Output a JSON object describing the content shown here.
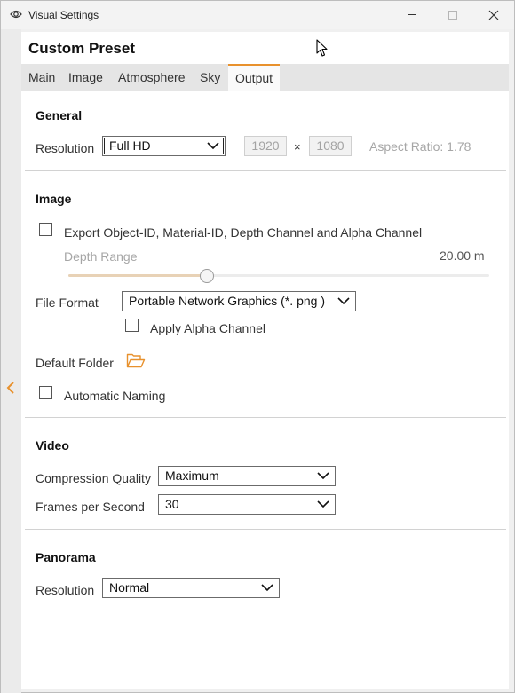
{
  "window": {
    "title": "Visual Settings"
  },
  "preset": {
    "title": "Custom Preset"
  },
  "tabs": [
    {
      "label": "Main"
    },
    {
      "label": "Image"
    },
    {
      "label": "Atmosphere"
    },
    {
      "label": "Sky"
    },
    {
      "label": "Output",
      "active": true
    }
  ],
  "general": {
    "heading": "General",
    "resolution_label": "Resolution",
    "resolution_value": "Full HD",
    "width": "1920",
    "times": "×",
    "height": "1080",
    "aspect_ratio": "Aspect Ratio: 1.78"
  },
  "image": {
    "heading": "Image",
    "export_label": "Export Object-ID, Material-ID, Depth Channel and Alpha Channel",
    "export_checked": false,
    "depth_range_label": "Depth Range",
    "depth_range_value": "20.00  m",
    "depth_range_fraction": 0.33,
    "file_format_label": "File Format",
    "file_format_value": "Portable Network Graphics  (*. png )",
    "apply_alpha_label": "Apply Alpha Channel",
    "apply_alpha_checked": false,
    "default_folder_label": "Default Folder",
    "automatic_naming_label": "Automatic Naming",
    "automatic_naming_checked": false
  },
  "video": {
    "heading": "Video",
    "compression_label": "Compression Quality",
    "compression_value": "Maximum",
    "fps_label": "Frames per Second",
    "fps_value": "30"
  },
  "panorama": {
    "heading": "Panorama",
    "resolution_label": "Resolution",
    "resolution_value": "Normal"
  },
  "colors": {
    "accent": "#e8912d"
  },
  "icons": {
    "app": "eye-icon",
    "minimize": "minimize-icon",
    "maximize": "maximize-icon",
    "close": "close-icon",
    "side": "chevron-left-icon",
    "folder": "folder-open-icon",
    "dropdown": "chevron-down-icon",
    "cursor": "mouse-pointer-icon"
  }
}
